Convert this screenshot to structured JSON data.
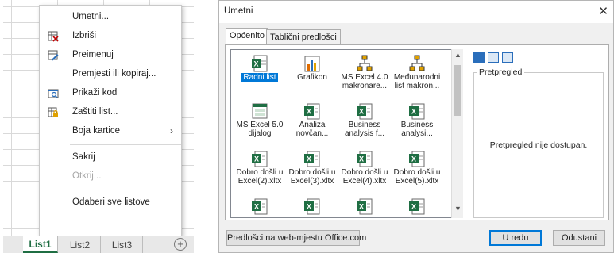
{
  "context_menu": {
    "items": [
      {
        "label": "Umetni...",
        "icon": "none",
        "disabled": false
      },
      {
        "label": "Izbriši",
        "icon": "delete-sheet-icon",
        "disabled": false
      },
      {
        "label": "Preimenuj",
        "icon": "rename-sheet-icon",
        "disabled": false
      },
      {
        "label": "Premjesti ili kopiraj...",
        "icon": "none",
        "disabled": false
      },
      {
        "label": "Prikaži kod",
        "icon": "view-code-icon",
        "disabled": false
      },
      {
        "label": "Zaštiti list...",
        "icon": "protect-sheet-icon",
        "disabled": false
      },
      {
        "label": "Boja kartice",
        "icon": "none",
        "disabled": false,
        "submenu": true
      },
      {
        "label": "Sakrij",
        "icon": "none",
        "disabled": false
      },
      {
        "label": "Otkrij...",
        "icon": "none",
        "disabled": true
      },
      {
        "label": "Odaberi sve listove",
        "icon": "none",
        "disabled": false
      }
    ],
    "submenu_arrow": "›"
  },
  "sheet_tabs": {
    "tabs": [
      "List1",
      "List2",
      "List3"
    ],
    "active": "List1",
    "add_symbol": "+"
  },
  "dialog": {
    "title": "Umetni",
    "close_symbol": "✕",
    "tabs": [
      "Općenito",
      "Tablični predlošci"
    ],
    "active_tab": "Općenito",
    "items": [
      {
        "label": "Radni list",
        "icon": "worksheet-icon",
        "selected": true
      },
      {
        "label": "Grafikon",
        "icon": "chart-icon",
        "selected": false
      },
      {
        "label": "MS Excel 4.0 makronare...",
        "icon": "macro-sheet-icon",
        "selected": false
      },
      {
        "label": "Međunarodni list makron...",
        "icon": "macro-sheet-icon",
        "selected": false
      },
      {
        "label": "MS Excel 5.0 dijalog",
        "icon": "dialog-sheet-icon",
        "selected": false
      },
      {
        "label": "Analiza novčan...",
        "icon": "template-icon",
        "selected": false
      },
      {
        "label": "Business analysis f...",
        "icon": "template-icon",
        "selected": false
      },
      {
        "label": "Business analysi...",
        "icon": "template-icon",
        "selected": false
      },
      {
        "label": "Dobro došli u Excel(2).xltx",
        "icon": "template-icon",
        "selected": false
      },
      {
        "label": "Dobro došli u Excel(3).xltx",
        "icon": "template-icon",
        "selected": false
      },
      {
        "label": "Dobro došli u Excel(4).xltx",
        "icon": "template-icon",
        "selected": false
      },
      {
        "label": "Dobro došli u Excel(5).xltx",
        "icon": "template-icon",
        "selected": false
      },
      {
        "label": "",
        "icon": "template-icon",
        "selected": false
      },
      {
        "label": "",
        "icon": "template-icon",
        "selected": false
      },
      {
        "label": "",
        "icon": "template-icon",
        "selected": false
      },
      {
        "label": "",
        "icon": "template-icon",
        "selected": false
      }
    ],
    "view_buttons": [
      "large-icons-icon",
      "list-icon",
      "details-icon"
    ],
    "preview_legend": "Pretpregled",
    "preview_message": "Pretpregled nije dostupan.",
    "online_button": "Predlošci na web-mjestu Office.com",
    "ok_button": "U redu",
    "cancel_button": "Odustani"
  },
  "colors": {
    "excel_green": "#1f6e43",
    "selection_blue": "#0078d7"
  }
}
